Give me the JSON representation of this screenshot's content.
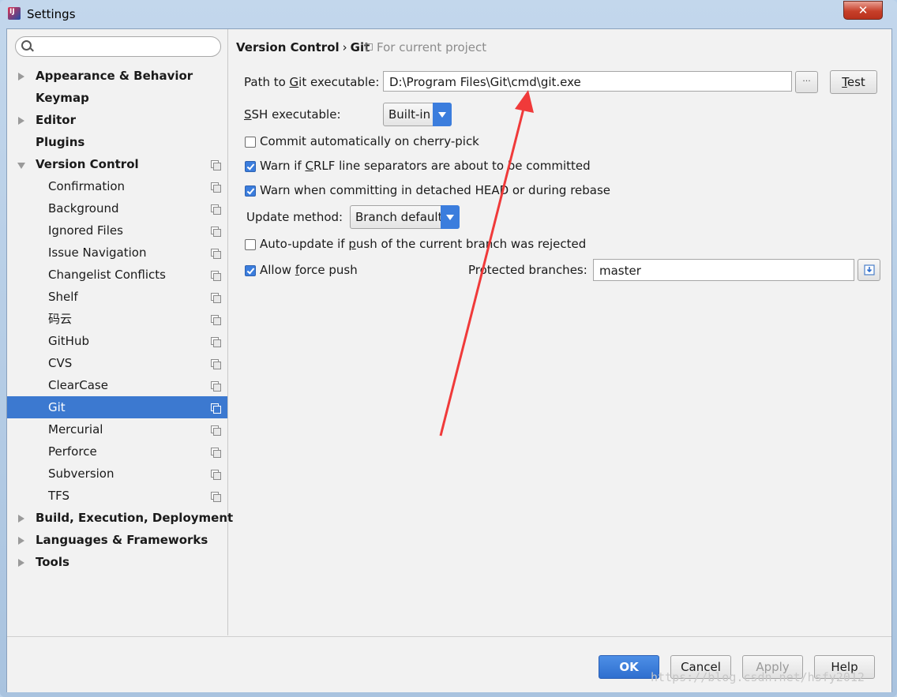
{
  "window": {
    "title": "Settings",
    "close_label": "✕"
  },
  "search": {
    "placeholder": ""
  },
  "sidebar": {
    "items": [
      {
        "label": "Appearance & Behavior",
        "level": 0,
        "expander": "right",
        "project": false,
        "selected": false
      },
      {
        "label": "Keymap",
        "level": 0,
        "expander": "none",
        "project": false,
        "selected": false
      },
      {
        "label": "Editor",
        "level": 0,
        "expander": "right",
        "project": false,
        "selected": false
      },
      {
        "label": "Plugins",
        "level": 0,
        "expander": "none",
        "project": false,
        "selected": false
      },
      {
        "label": "Version Control",
        "level": 0,
        "expander": "down",
        "project": true,
        "selected": false
      },
      {
        "label": "Confirmation",
        "level": 1,
        "expander": "none",
        "project": true,
        "selected": false
      },
      {
        "label": "Background",
        "level": 1,
        "expander": "none",
        "project": true,
        "selected": false
      },
      {
        "label": "Ignored Files",
        "level": 1,
        "expander": "none",
        "project": true,
        "selected": false
      },
      {
        "label": "Issue Navigation",
        "level": 1,
        "expander": "none",
        "project": true,
        "selected": false
      },
      {
        "label": "Changelist Conflicts",
        "level": 1,
        "expander": "none",
        "project": true,
        "selected": false
      },
      {
        "label": "Shelf",
        "level": 1,
        "expander": "none",
        "project": true,
        "selected": false
      },
      {
        "label": "码云",
        "level": 1,
        "expander": "none",
        "project": true,
        "selected": false
      },
      {
        "label": "GitHub",
        "level": 1,
        "expander": "none",
        "project": true,
        "selected": false
      },
      {
        "label": "CVS",
        "level": 1,
        "expander": "none",
        "project": true,
        "selected": false
      },
      {
        "label": "ClearCase",
        "level": 1,
        "expander": "none",
        "project": true,
        "selected": false
      },
      {
        "label": "Git",
        "level": 1,
        "expander": "none",
        "project": true,
        "selected": true
      },
      {
        "label": "Mercurial",
        "level": 1,
        "expander": "none",
        "project": true,
        "selected": false
      },
      {
        "label": "Perforce",
        "level": 1,
        "expander": "none",
        "project": true,
        "selected": false
      },
      {
        "label": "Subversion",
        "level": 1,
        "expander": "none",
        "project": true,
        "selected": false
      },
      {
        "label": "TFS",
        "level": 1,
        "expander": "none",
        "project": true,
        "selected": false
      },
      {
        "label": "Build, Execution, Deployment",
        "level": 0,
        "expander": "right",
        "project": false,
        "selected": false
      },
      {
        "label": "Languages & Frameworks",
        "level": 0,
        "expander": "right",
        "project": false,
        "selected": false
      },
      {
        "label": "Tools",
        "level": 0,
        "expander": "right",
        "project": false,
        "selected": false
      }
    ]
  },
  "breadcrumb": {
    "parent": "Version Control",
    "separator": "›",
    "current": "Git",
    "hint": "For current project"
  },
  "git": {
    "path_label_pre": "Path to ",
    "path_label_u": "G",
    "path_label_post": "it executable:",
    "path_value": "D:\\Program Files\\Git\\cmd\\git.exe",
    "browse_label": "···",
    "test_label_u": "T",
    "test_label_post": "est",
    "ssh_label_u": "S",
    "ssh_label_post": "SH executable:",
    "ssh_value": "Built-in",
    "cherry_pick_label": "Commit automatically on cherry-pick",
    "cherry_pick_checked": false,
    "crlf_label_pre": "Warn if ",
    "crlf_label_u": "C",
    "crlf_label_post": "RLF line separators are about to be committed",
    "crlf_checked": true,
    "detached_label": "Warn when committing in detached HEAD or during rebase",
    "detached_checked": true,
    "update_method_label": "Update method:",
    "update_method_value": "Branch default",
    "auto_update_label_pre": "Auto-update if ",
    "auto_update_label_u": "p",
    "auto_update_label_post": "ush of the current branch was rejected",
    "auto_update_checked": false,
    "force_push_label_pre": "Allow ",
    "force_push_label_u": "f",
    "force_push_label_post": "orce push",
    "force_push_checked": true,
    "protected_label": "Protected branches:",
    "protected_value": "master"
  },
  "footer": {
    "ok": "OK",
    "cancel": "Cancel",
    "apply": "Apply",
    "help": "Help"
  },
  "watermark": "https://blog.csdn.net/hsfy2012",
  "colors": {
    "selection": "#3c79d0",
    "accent": "#3b7ddd",
    "annotation_arrow": "#f03a3a"
  }
}
